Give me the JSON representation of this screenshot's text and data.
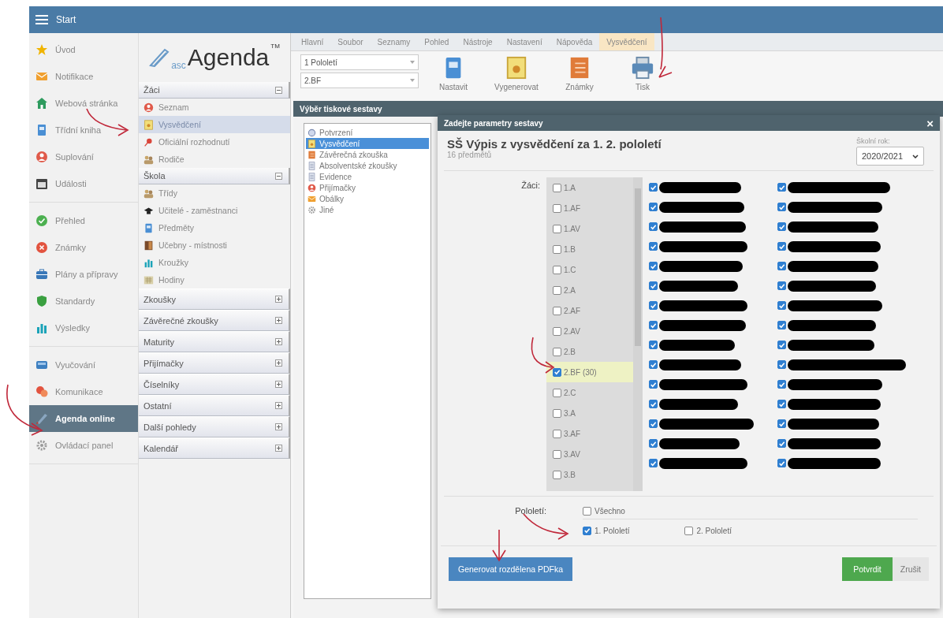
{
  "top_bar": {
    "title": "Start"
  },
  "nav": {
    "groups": [
      [
        {
          "label": "Úvod",
          "selected": false
        },
        {
          "label": "Notifikace",
          "selected": false
        },
        {
          "label": "Webová stránka",
          "selected": false
        },
        {
          "label": "Třídní kniha",
          "selected": false
        },
        {
          "label": "Suplování",
          "selected": false
        },
        {
          "label": "Události",
          "selected": false
        }
      ],
      [
        {
          "label": "Přehled",
          "selected": false
        },
        {
          "label": "Známky",
          "selected": false
        },
        {
          "label": "Plány a přípravy",
          "selected": false
        },
        {
          "label": "Standardy",
          "selected": false
        },
        {
          "label": "Výsledky",
          "selected": false
        }
      ],
      [
        {
          "label": "Vyučování",
          "selected": false
        },
        {
          "label": "Komunikace",
          "selected": false
        },
        {
          "label": "Agenda online",
          "selected": true
        },
        {
          "label": "Ovládací panel",
          "selected": false
        }
      ]
    ]
  },
  "logo": {
    "prefix": "asc",
    "name": "Agenda",
    "mark": "TM"
  },
  "sections": [
    {
      "title": "Žáci",
      "expanded": true,
      "items": [
        {
          "label": "Seznam",
          "selected": false
        },
        {
          "label": "Vysvědčení",
          "selected": true
        },
        {
          "label": "Oficiální rozhodnutí",
          "selected": false
        },
        {
          "label": "Rodiče",
          "selected": false
        }
      ]
    },
    {
      "title": "Škola",
      "expanded": true,
      "items": [
        {
          "label": "Třídy",
          "selected": false
        },
        {
          "label": "Učitelé - zaměstnanci",
          "selected": false
        },
        {
          "label": "Předměty",
          "selected": false
        },
        {
          "label": "Učebny - místnosti",
          "selected": false
        },
        {
          "label": "Kroužky",
          "selected": false
        },
        {
          "label": "Hodiny",
          "selected": false
        }
      ]
    },
    {
      "title": "Zkoušky",
      "expanded": false
    },
    {
      "title": "Závěrečné zkoušky",
      "expanded": false
    },
    {
      "title": "Maturity",
      "expanded": false
    },
    {
      "title": "Přijímačky",
      "expanded": false
    },
    {
      "title": "Číselníky",
      "expanded": false
    },
    {
      "title": "Ostatní",
      "expanded": false
    },
    {
      "title": "Další pohledy",
      "expanded": false
    },
    {
      "title": "Kalendář",
      "expanded": false
    }
  ],
  "ribbon_tabs": [
    {
      "label": "Hlavní",
      "selected": false
    },
    {
      "label": "Soubor",
      "selected": false
    },
    {
      "label": "Seznamy",
      "selected": false
    },
    {
      "label": "Pohled",
      "selected": false
    },
    {
      "label": "Nástroje",
      "selected": false
    },
    {
      "label": "Nastavení",
      "selected": false
    },
    {
      "label": "Nápověda",
      "selected": false
    },
    {
      "label": "Vysvědčení",
      "selected": true
    }
  ],
  "ribbon": {
    "selects": [
      "1 Pololetí",
      "2.BF"
    ],
    "buttons": [
      "Nastavit",
      "Vygenerovat",
      "Známky",
      "Tisk"
    ]
  },
  "print_dialog": {
    "title": "Výběr tiskové sestavy",
    "items": [
      {
        "label": "Potvrzení",
        "selected": false
      },
      {
        "label": "Vysvědčení",
        "selected": true
      },
      {
        "label": "Závěrečná zkouška",
        "selected": false
      },
      {
        "label": "Absolventské zkoušky",
        "selected": false
      },
      {
        "label": "Evidence",
        "selected": false
      },
      {
        "label": "Přijímačky",
        "selected": false
      },
      {
        "label": "Obálky",
        "selected": false
      },
      {
        "label": "Jiné",
        "selected": false
      }
    ]
  },
  "modal": {
    "title": "Zadejte parametry sestavy",
    "close": "×",
    "heading": "SŠ Výpis z vysvědčení za 1. 2. pololetí",
    "subtitle": "16 předmětů",
    "school_year_label": "Školní rok:",
    "school_year": "2020/2021",
    "students_label": "Žáci:",
    "classes": [
      {
        "label": "1.A",
        "checked": false
      },
      {
        "label": "1.AF",
        "checked": false
      },
      {
        "label": "1.AV",
        "checked": false
      },
      {
        "label": "1.B",
        "checked": false
      },
      {
        "label": "1.C",
        "checked": false
      },
      {
        "label": "2.A",
        "checked": false
      },
      {
        "label": "2.AF",
        "checked": false
      },
      {
        "label": "2.AV",
        "checked": false
      },
      {
        "label": "2.B",
        "checked": false
      },
      {
        "label": "2.BF (30)",
        "checked": true
      },
      {
        "label": "2.C",
        "checked": false
      },
      {
        "label": "3.A",
        "checked": false
      },
      {
        "label": "3.AF",
        "checked": false
      },
      {
        "label": "3.AV",
        "checked": false
      },
      {
        "label": "3.B",
        "checked": false
      }
    ],
    "students": [
      [
        {
          "checked": true
        },
        {
          "checked": true
        },
        {
          "checked": true
        },
        {
          "checked": true
        },
        {
          "checked": true
        },
        {
          "checked": true
        },
        {
          "checked": true
        },
        {
          "checked": true
        },
        {
          "checked": true
        },
        {
          "checked": true
        },
        {
          "checked": true
        },
        {
          "checked": true
        },
        {
          "checked": true
        },
        {
          "checked": true
        },
        {
          "checked": true
        }
      ],
      [
        {
          "checked": true
        },
        {
          "checked": true
        },
        {
          "checked": true
        },
        {
          "checked": true
        },
        {
          "checked": true
        },
        {
          "checked": true
        },
        {
          "checked": true
        },
        {
          "checked": true
        },
        {
          "checked": true
        },
        {
          "checked": true
        },
        {
          "checked": true
        },
        {
          "checked": true
        },
        {
          "checked": true
        },
        {
          "checked": true
        },
        {
          "checked": true
        }
      ]
    ],
    "semester_label": "Pololetí:",
    "semesters": [
      {
        "label": "Všechno",
        "checked": false
      },
      {
        "label": "1. Pololetí",
        "checked": true
      },
      {
        "label": "2. Pololetí",
        "checked": false
      }
    ],
    "buttons": {
      "generate": "Generovat rozdělena PDFka",
      "confirm": "Potvrdit",
      "cancel": "Zrušit"
    }
  }
}
